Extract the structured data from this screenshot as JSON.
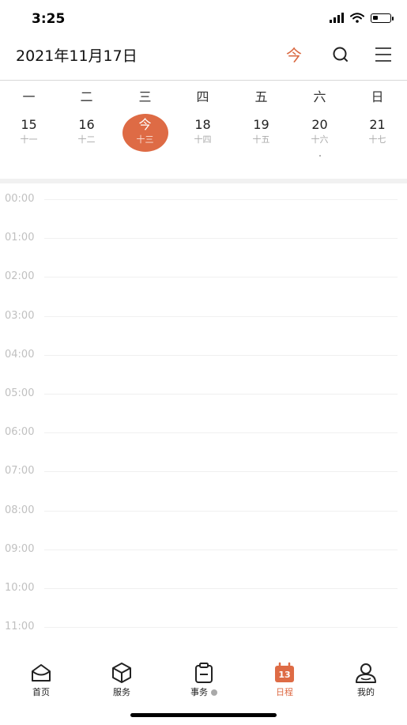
{
  "status": {
    "time": "3:25",
    "battery_level": 0.3
  },
  "header": {
    "title": "2021年11月17日",
    "today_label": "今"
  },
  "week": {
    "weekdays": [
      "一",
      "二",
      "三",
      "四",
      "五",
      "六",
      "日"
    ],
    "days": [
      {
        "num": "15",
        "lunar": "十一"
      },
      {
        "num": "16",
        "lunar": "十二"
      },
      {
        "num": "今",
        "lunar": "十三",
        "selected": true
      },
      {
        "num": "18",
        "lunar": "十四"
      },
      {
        "num": "19",
        "lunar": "十五"
      },
      {
        "num": "20",
        "lunar": "十六",
        "dot": true
      },
      {
        "num": "21",
        "lunar": "十七"
      }
    ]
  },
  "timeline": {
    "hours": [
      "00:00",
      "01:00",
      "02:00",
      "03:00",
      "04:00",
      "05:00",
      "06:00",
      "07:00",
      "08:00",
      "09:00",
      "10:00",
      "11:00"
    ]
  },
  "tabs": [
    {
      "label": "首页",
      "icon": "home-icon"
    },
    {
      "label": "服务",
      "icon": "cube-icon"
    },
    {
      "label": "事务",
      "icon": "clipboard-icon",
      "badge": true
    },
    {
      "label": "日程",
      "icon": "calendar-icon",
      "active": true,
      "icon_text": "13"
    },
    {
      "label": "我的",
      "icon": "user-icon"
    }
  ],
  "colors": {
    "accent": "#de6b45",
    "text": "#222222",
    "muted": "#c0c0c0"
  }
}
